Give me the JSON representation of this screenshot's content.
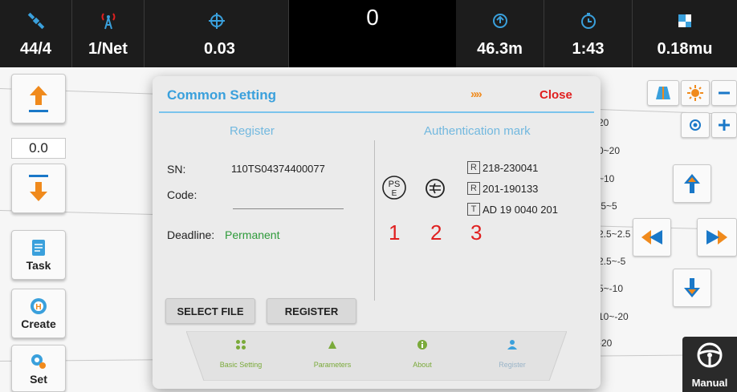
{
  "topbar": {
    "cells": [
      {
        "icon": "satellite-icon",
        "value": "44/4"
      },
      {
        "icon": "signal-antenna-icon",
        "value": "1/Net"
      },
      {
        "icon": "target-icon",
        "value": "0.03"
      },
      {
        "icon": "altitude-icon",
        "value": "46.3m"
      },
      {
        "icon": "timer-icon",
        "value": "1:43"
      },
      {
        "icon": "area-icon",
        "value": "0.18mu"
      }
    ],
    "center_value": "0"
  },
  "left_toolbar": {
    "up_value": "0.0",
    "task_label": "Task",
    "create_label": "Create",
    "set_label": "Set"
  },
  "legend": [
    "20",
    "0~20",
    "~10",
    ".5~5",
    "2.5~2.5",
    "2.5~-5",
    "5~-10",
    "10~-20",
    "-20"
  ],
  "dialog": {
    "title": "Common Setting",
    "arrows": "»»",
    "close_label": "Close",
    "register_title": "Register",
    "auth_title": "Authentication mark",
    "sn_label": "SN:",
    "sn_value": "110TS04374400077",
    "code_label": "Code:",
    "deadline_label": "Deadline:",
    "deadline_value": "Permanent",
    "certs": [
      {
        "box": "R",
        "text": "218-230041"
      },
      {
        "box": "R",
        "text": "201-190133"
      },
      {
        "box": "T",
        "text": "AD 19 0040 201"
      }
    ],
    "marks": [
      "1",
      "2",
      "3"
    ],
    "select_file_label": "SELECT FILE",
    "register_label": "REGISTER",
    "tabs": [
      {
        "icon": "grid-icon",
        "label": "Basic Setting"
      },
      {
        "icon": "parameters-icon",
        "label": "Parameters"
      },
      {
        "icon": "info-icon",
        "label": "About"
      },
      {
        "icon": "user-icon",
        "label": "Register"
      }
    ]
  },
  "manual_label": "Manual",
  "colors": {
    "accent": "#3aa0dc",
    "close": "#e01e1e",
    "permanent": "#2e9a3a",
    "mark": "#e02020",
    "orange": "#f08a1c",
    "nav_blue": "#1a78c8"
  }
}
